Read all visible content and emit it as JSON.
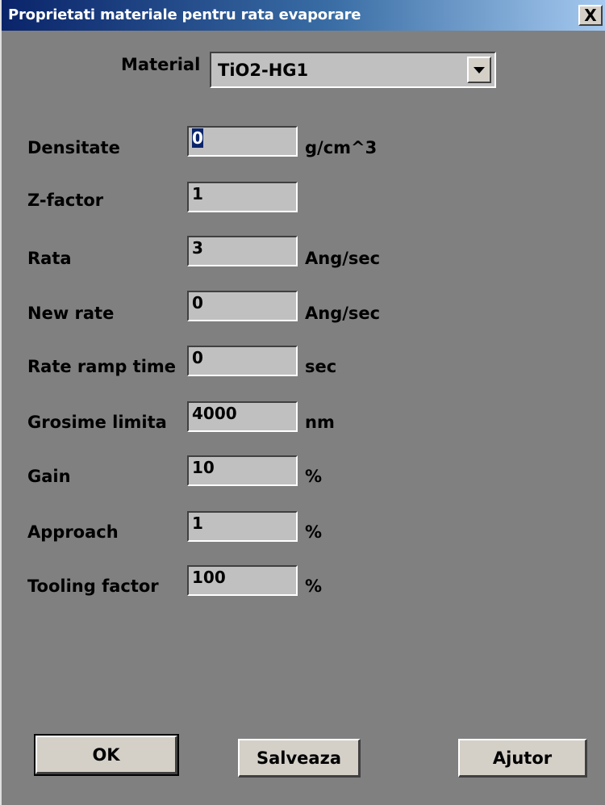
{
  "window": {
    "title": "Proprietati materiale pentru rata evaporare",
    "close_label": "X"
  },
  "material": {
    "label": "Material",
    "value": "TiO2-HG1"
  },
  "fields": [
    {
      "label": "Densitate",
      "value": "0",
      "unit": "g/cm^3"
    },
    {
      "label": "Z-factor",
      "value": "1",
      "unit": ""
    },
    {
      "label": "Rata",
      "value": "3",
      "unit": "Ang/sec"
    },
    {
      "label": "New rate",
      "value": "0",
      "unit": "Ang/sec"
    },
    {
      "label": "Rate ramp time",
      "value": "0",
      "unit": "sec"
    },
    {
      "label": "Grosime limita",
      "value": "4000",
      "unit": "nm"
    },
    {
      "label": "Gain",
      "value": "10",
      "unit": "%"
    },
    {
      "label": "Approach",
      "value": "1",
      "unit": "%"
    },
    {
      "label": "Tooling factor",
      "value": "100",
      "unit": "%"
    }
  ],
  "buttons": {
    "ok": "OK",
    "save": "Salveaza",
    "help": "Ajutor"
  },
  "colors": {
    "titlebar_start": "#0a246a",
    "titlebar_end": "#a6caf0",
    "dialog_background": "#808080",
    "field_background": "#c0c0c0"
  }
}
